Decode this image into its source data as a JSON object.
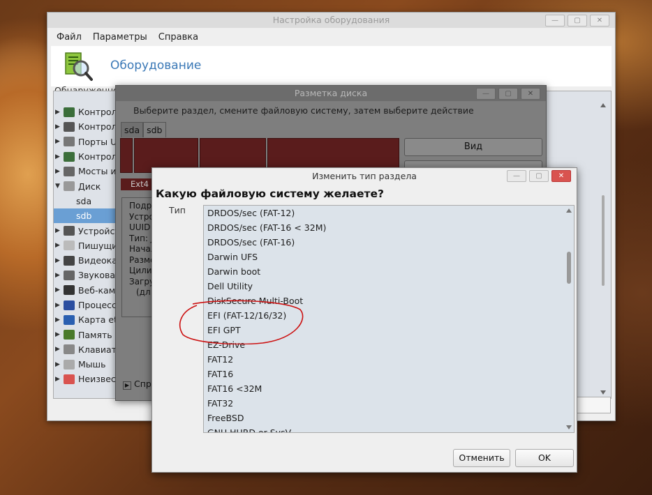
{
  "main_window": {
    "title": "Настройка оборудования",
    "menu": [
      "Файл",
      "Параметры",
      "Справка"
    ],
    "header_title": "Оборудование",
    "detected_label": "Обнаруженное",
    "tree": [
      {
        "label": "Контролл",
        "icon": "controller-icon",
        "expander": "▶",
        "level": 0
      },
      {
        "label": "Контролл",
        "icon": "usb-icon",
        "expander": "▶",
        "level": 0
      },
      {
        "label": "Порты U",
        "icon": "port-icon",
        "expander": "▶",
        "level": 0
      },
      {
        "label": "Контрол",
        "icon": "controller-icon",
        "expander": "▶",
        "level": 0
      },
      {
        "label": "Мосты и",
        "icon": "bridge-icon",
        "expander": "▶",
        "level": 0
      },
      {
        "label": "Диск",
        "icon": "disk-icon",
        "expander": "▼",
        "level": 0
      },
      {
        "label": "sda",
        "icon": "",
        "expander": "",
        "level": 1
      },
      {
        "label": "sdb",
        "icon": "",
        "expander": "",
        "level": 1,
        "selected": true
      },
      {
        "label": "Устройст",
        "icon": "usb-icon",
        "expander": "▶",
        "level": 0
      },
      {
        "label": "Пишущие",
        "icon": "optical-drive-icon",
        "expander": "▶",
        "level": 0
      },
      {
        "label": "Видеокар",
        "icon": "video-card-icon",
        "expander": "▶",
        "level": 0
      },
      {
        "label": "Звуковая",
        "icon": "speaker-icon",
        "expander": "▶",
        "level": 0
      },
      {
        "label": "Веб-каме",
        "icon": "webcam-icon",
        "expander": "▶",
        "level": 0
      },
      {
        "label": "Процессо",
        "icon": "cpu-icon",
        "expander": "▶",
        "level": 0
      },
      {
        "label": "Карта et",
        "icon": "network-card-icon",
        "expander": "▶",
        "level": 0
      },
      {
        "label": "Память",
        "icon": "memory-icon",
        "expander": "▶",
        "level": 0
      },
      {
        "label": "Клавиату",
        "icon": "keyboard-icon",
        "expander": "▶",
        "level": 0
      },
      {
        "label": "Мышь",
        "icon": "mouse-icon",
        "expander": "▶",
        "level": 0
      },
      {
        "label": "Неизвест",
        "icon": "unknown-device-icon",
        "expander": "▶",
        "level": 0
      }
    ]
  },
  "partition_window": {
    "title": "Разметка диска",
    "instruction": "Выберите раздел, смените файловую систему, затем выберите действие",
    "tabs": [
      "sda",
      "sdb"
    ],
    "view_button": "Вид",
    "second_button": "Т",
    "fs_badge": "Ext4",
    "details_labels": [
      "Подро",
      "Устро",
      "UUID",
      "Тип: J",
      "Начал",
      "Разме",
      "Цили",
      "Загру",
      "(дл"
    ],
    "spr_label": "Спр"
  },
  "type_dialog": {
    "title": "Изменить тип раздела",
    "question": "Какую файловую систему желаете?",
    "type_label": "Тип",
    "items": [
      "DRDOS/sec (FAT-12)",
      "DRDOS/sec (FAT-16 < 32M)",
      "DRDOS/sec (FAT-16)",
      "Darwin UFS",
      "Darwin boot",
      "Dell Utility",
      "DiskSecure Multi-Boot",
      "EFI (FAT-12/16/32)",
      "EFI GPT",
      "EZ-Drive",
      "FAT12",
      "FAT16",
      "FAT16 <32M",
      "FAT32",
      "FreeBSD",
      "GNU HURD or SysV"
    ],
    "cancel_button": "Отменить",
    "ok_button": "OK"
  },
  "colors": {
    "selection": "#6a9fd4",
    "header_title": "#3a78b6",
    "partition_bar": "#5a1c1c",
    "annotation_circle": "#cc1111"
  }
}
